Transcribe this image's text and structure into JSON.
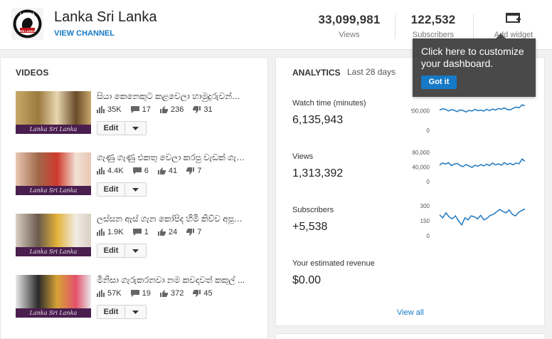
{
  "channel": {
    "logo_text_top": "LANKA",
    "logo_text_bottom": "SRI LANKA",
    "name": "Lanka Sri Lanka",
    "view_channel_label": "VIEW CHANNEL"
  },
  "header_stats": {
    "views": {
      "value": "33,099,981",
      "label": "Views"
    },
    "subscribers": {
      "value": "122,532",
      "label": "Subscribers"
    },
    "add_widget_label": "Add widget"
  },
  "videos": {
    "title": "VIDEOS",
    "thumb_caption": "Lanka Sri Lanka",
    "items": [
      {
        "title": "සියා කෙනෙකුට කළවෙලා හාමුදුරුවන්ට කි...",
        "views": "35K",
        "comments": "17",
        "likes": "236",
        "dislikes": "31",
        "edit_label": "Edit"
      },
      {
        "title": "ගැණු ගැණු එකතු වෙලා කරපු වැඩක් ගැන...",
        "views": "4.4K",
        "comments": "6",
        "likes": "41",
        "dislikes": "7",
        "edit_label": "Edit"
      },
      {
        "title": "ලස්සන ඇස් ගැන කෝපිද හිමි කිව්ව අපූරු ...",
        "views": "1.9K",
        "comments": "1",
        "likes": "24",
        "dislikes": "7",
        "edit_label": "Edit"
      },
      {
        "title": "මිනිසා ගැරුකරනවා නම කවදාවත් කකුල් ...",
        "views": "57K",
        "comments": "19",
        "likes": "372",
        "dislikes": "45",
        "edit_label": "Edit"
      }
    ]
  },
  "analytics": {
    "title": "ANALYTICS",
    "range": "Last 28 days",
    "metrics": [
      {
        "label": "Watch time (minutes)",
        "value": "6,135,943",
        "axis_top": "200,000",
        "axis_bottom": "0"
      },
      {
        "label": "Views",
        "value": "1,313,392",
        "axis_top": "80,000",
        "axis_mid": "40,000",
        "axis_bottom": "0"
      },
      {
        "label": "Subscribers",
        "value": "+5,538",
        "axis_top": "300",
        "axis_mid": "150",
        "axis_bottom": "0"
      },
      {
        "label": "Your estimated revenue",
        "value": "$0.00"
      }
    ],
    "view_all_label": "View all"
  },
  "tooltip": {
    "text": "Click here to customize your dashboard.",
    "button_label": "Got it"
  },
  "chart_data": [
    {
      "type": "line",
      "title": "Watch time (minutes)",
      "ylim": [
        0,
        260000
      ],
      "ticks": [
        0,
        200000
      ],
      "values": [
        205000,
        218000,
        214000,
        196000,
        210000,
        202000,
        190000,
        208000,
        200000,
        186000,
        204000,
        196000,
        212000,
        199000,
        205000,
        195000,
        214000,
        200000,
        216000,
        205000,
        222000,
        214000,
        228000,
        211000,
        207000,
        224000,
        236000,
        228000,
        258000,
        250000
      ]
    },
    {
      "type": "line",
      "title": "Views",
      "ylim": [
        0,
        90000
      ],
      "ticks": [
        0,
        40000,
        80000
      ],
      "values": [
        45000,
        51000,
        48000,
        52000,
        44000,
        48000,
        50000,
        44000,
        41000,
        47000,
        43000,
        39000,
        45000,
        42000,
        47000,
        43000,
        48000,
        44000,
        51000,
        46000,
        49000,
        45000,
        52000,
        47000,
        50000,
        46000,
        51000,
        49000,
        62000,
        56000
      ]
    },
    {
      "type": "line",
      "title": "Subscribers",
      "ylim": [
        0,
        330
      ],
      "ticks": [
        0,
        150,
        300
      ],
      "values": [
        210,
        180,
        230,
        190,
        170,
        200,
        150,
        110,
        180,
        160,
        200,
        190,
        170,
        205,
        160,
        175,
        205,
        215,
        240,
        265,
        245,
        230,
        260,
        215,
        200,
        235,
        255,
        270
      ]
    }
  ]
}
